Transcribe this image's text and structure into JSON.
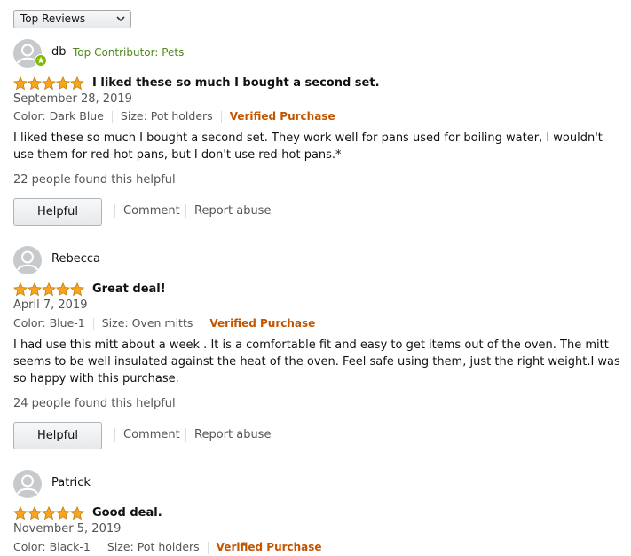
{
  "sort": {
    "selected": "Top Reviews"
  },
  "colors": {
    "star": "#f8a41c",
    "verified": "#c45500",
    "contributor": "#4e8a1d",
    "badge": "#7fba00"
  },
  "icons": {
    "avatar": "default-avatar-icon",
    "badge": "contributor-badge-icon",
    "rating": "star-icon",
    "dropdown": "chevron-down-icon"
  },
  "reviews": [
    {
      "reviewer": "db",
      "badge": "Top Contributor: Pets",
      "rating": 5,
      "title": "I liked these so much I bought a second set.",
      "date": "September 28, 2019",
      "color": "Color: Dark Blue",
      "size": "Size: Pot holders",
      "verified": "Verified Purchase",
      "text": "I liked these so much I bought a second set. They work well for pans used for boiling water, I wouldn't use them for red-hot pans, but I don't use red-hot pans.*",
      "helpful_count": "22 people found this helpful",
      "helpful_label": "Helpful",
      "comment_label": "Comment",
      "report_label": "Report abuse"
    },
    {
      "reviewer": "Rebecca",
      "rating": 5,
      "title": "Great deal!",
      "date": "April 7, 2019",
      "color": "Color: Blue-1",
      "size": "Size: Oven mitts",
      "verified": "Verified Purchase",
      "text": "I had use this mitt about a week . It is a comfortable fit and easy to get items out of the oven. The mitt seems to be well insulated against the heat of the oven. Feel safe using them, just the right weight.I was so happy with this purchase.",
      "helpful_count": "24 people found this helpful",
      "helpful_label": "Helpful",
      "comment_label": "Comment",
      "report_label": "Report abuse"
    },
    {
      "reviewer": "Patrick",
      "rating": 5,
      "title": "Good deal.",
      "date": "November 5, 2019",
      "color": "Color: Black-1",
      "size": "Size: Pot holders",
      "verified": "Verified Purchase"
    }
  ]
}
